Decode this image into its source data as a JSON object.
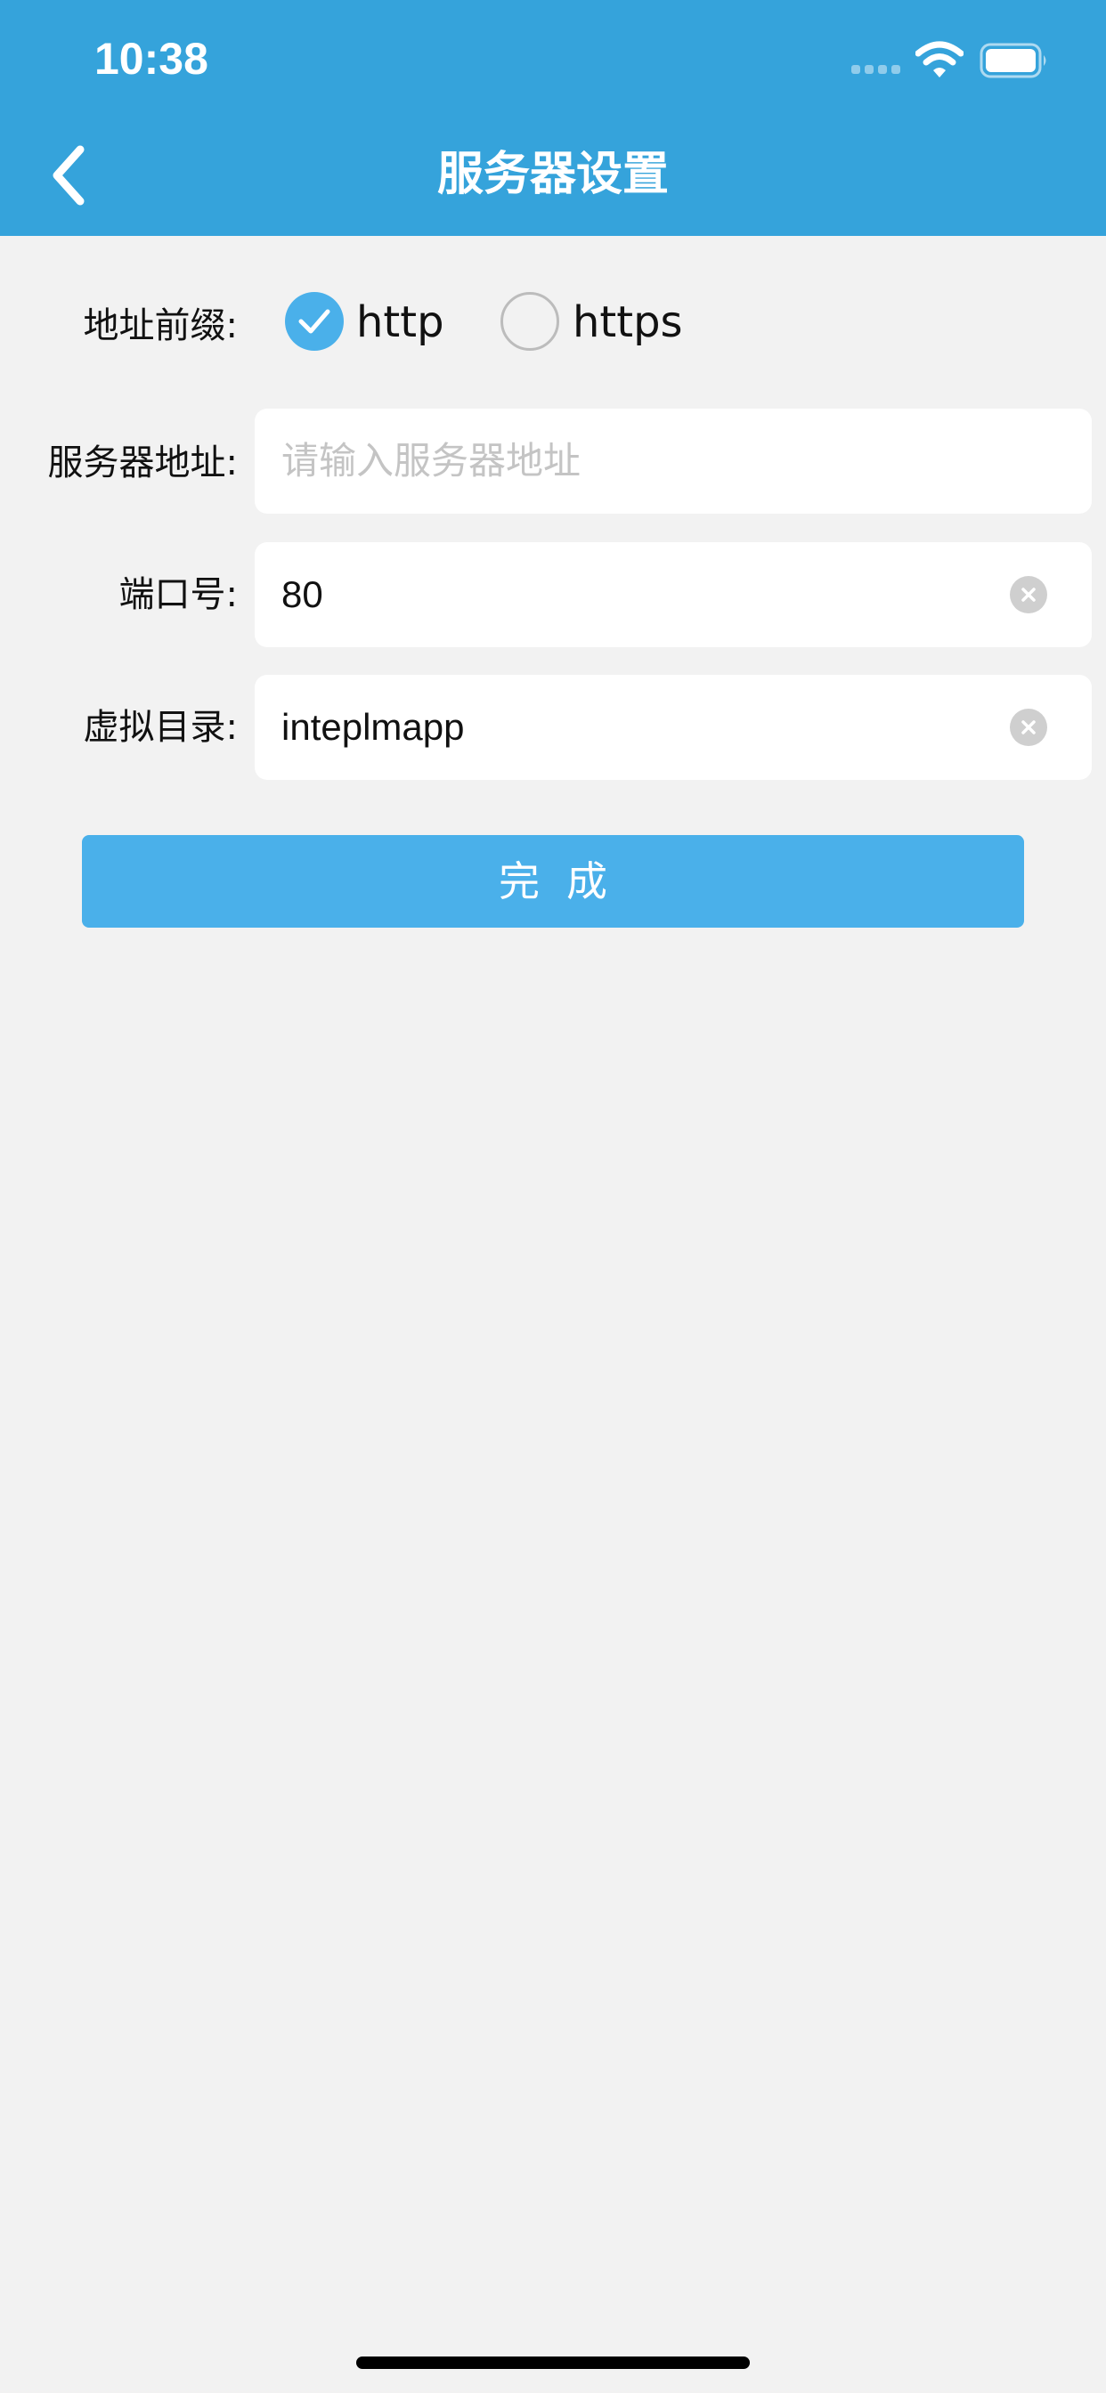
{
  "status_bar": {
    "time": "10:38"
  },
  "nav": {
    "title": "服务器设置",
    "back_icon": "chevron-left-icon"
  },
  "form": {
    "prefix_label": "地址前缀:",
    "prefix_options": [
      {
        "label": "http",
        "checked": true
      },
      {
        "label": "https",
        "checked": false
      }
    ],
    "server_label": "服务器地址:",
    "server_value": "",
    "server_placeholder": "请输入服务器地址",
    "port_label": "端口号:",
    "port_value": "80",
    "dir_label": "虚拟目录:",
    "dir_value": "inteplmapp"
  },
  "done_button": "完成",
  "colors": {
    "header_bg": "#35a3db",
    "accent": "#4ab0ea",
    "page_bg": "#f2f2f2"
  }
}
